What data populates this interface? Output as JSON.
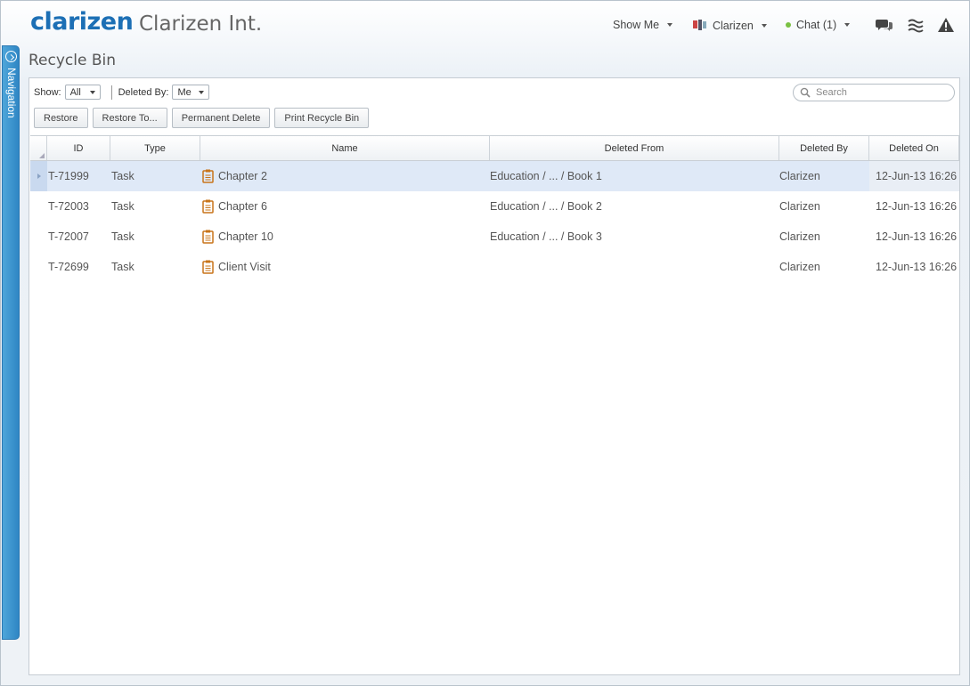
{
  "header": {
    "logo": "clarizen",
    "org_name": "Clarizen Int.",
    "show_me": "Show Me",
    "user_menu": "Clarizen",
    "chat": "Chat (1)",
    "icons": [
      "chat-bubbles-icon",
      "activity-stream-icon",
      "alert-icon"
    ]
  },
  "nav": {
    "label": "Navigation"
  },
  "page": {
    "title": "Recycle Bin"
  },
  "filters": {
    "show_label": "Show:",
    "show_value": "All",
    "deleted_by_label": "Deleted By:",
    "deleted_by_value": "Me"
  },
  "search": {
    "placeholder": "Search"
  },
  "toolbar": {
    "restore": "Restore",
    "restore_to": "Restore To...",
    "permanent_delete": "Permanent Delete",
    "print": "Print Recycle Bin"
  },
  "grid": {
    "columns": [
      "ID",
      "Type",
      "Name",
      "Deleted From",
      "Deleted By",
      "Deleted On"
    ],
    "rows": [
      {
        "id": "T-71999",
        "type": "Task",
        "name": "Chapter 2",
        "deleted_from": "Education / ... / Book 1",
        "deleted_by": "Clarizen",
        "deleted_on": "12-Jun-13 16:26"
      },
      {
        "id": "T-72003",
        "type": "Task",
        "name": "Chapter 6",
        "deleted_from": "Education / ... / Book 2",
        "deleted_by": "Clarizen",
        "deleted_on": "12-Jun-13 16:26"
      },
      {
        "id": "T-72007",
        "type": "Task",
        "name": "Chapter 10",
        "deleted_from": "Education / ... / Book 3",
        "deleted_by": "Clarizen",
        "deleted_on": "12-Jun-13 16:26"
      },
      {
        "id": "T-72699",
        "type": "Task",
        "name": "Client Visit",
        "deleted_from": "",
        "deleted_by": "Clarizen",
        "deleted_on": "12-Jun-13 16:26"
      }
    ]
  },
  "colors": {
    "brand": "#1c6fb5",
    "nav": "#3a94cf",
    "selected_row": "#dfe9f7",
    "task_icon": "#c8741a",
    "online": "#7ac142"
  }
}
